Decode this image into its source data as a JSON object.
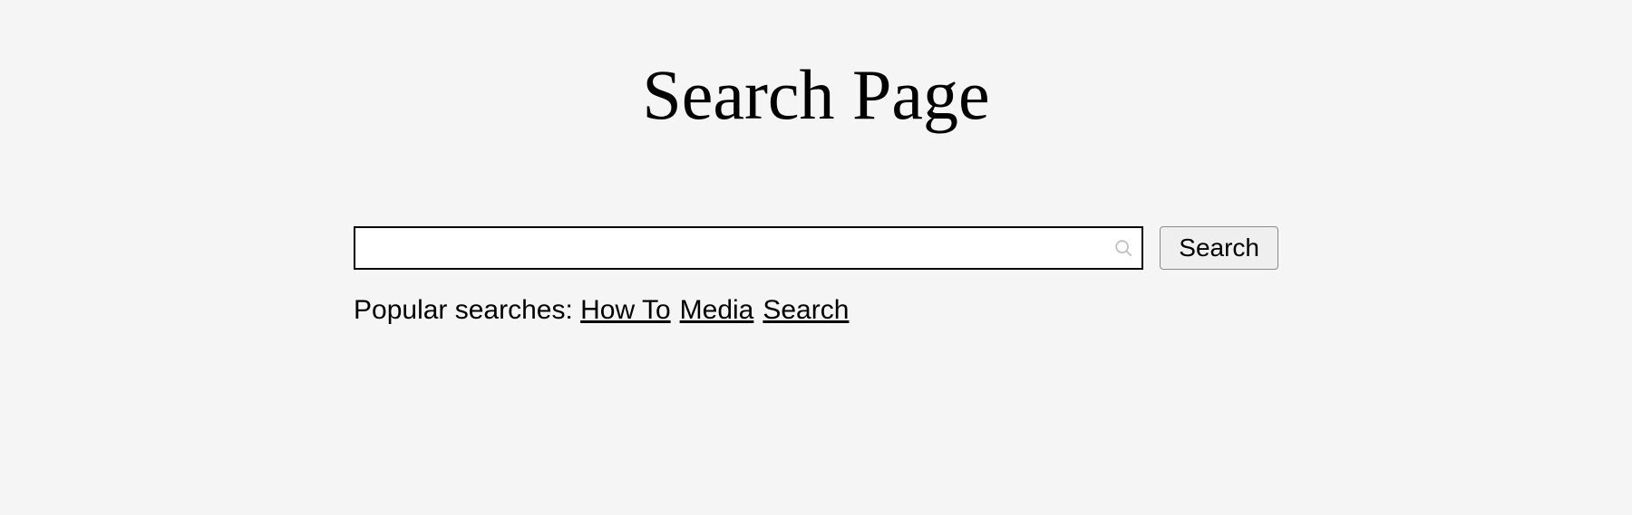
{
  "header": {
    "title": "Search Page"
  },
  "search": {
    "input_value": "",
    "placeholder": "",
    "button_label": "Search",
    "icon_name": "search-icon"
  },
  "popular": {
    "label": "Popular searches: ",
    "items": [
      "How To",
      "Media",
      "Search"
    ]
  }
}
